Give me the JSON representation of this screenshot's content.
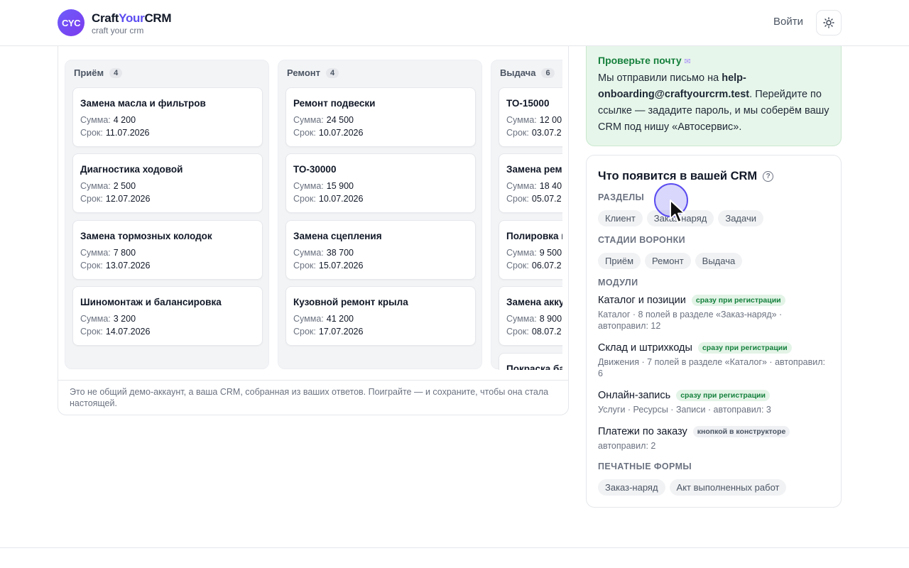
{
  "header": {
    "logo_text": "CYC",
    "brand_craft": "Craft",
    "brand_your": "Your",
    "brand_crm": "CRM",
    "brand_sub": "craft your crm",
    "login": "Войти"
  },
  "board": {
    "columns": [
      {
        "title": "Приём",
        "count": "4",
        "cards": [
          {
            "title": "Замена масла и фильтров",
            "sum": "4 200",
            "due": "11.07.2026"
          },
          {
            "title": "Диагностика ходовой",
            "sum": "2 500",
            "due": "12.07.2026"
          },
          {
            "title": "Замена тормозных колодок",
            "sum": "7 800",
            "due": "13.07.2026"
          },
          {
            "title": "Шиномонтаж и балансировка",
            "sum": "3 200",
            "due": "14.07.2026"
          }
        ]
      },
      {
        "title": "Ремонт",
        "count": "4",
        "cards": [
          {
            "title": "Ремонт подвески",
            "sum": "24 500",
            "due": "10.07.2026"
          },
          {
            "title": "ТО-30000",
            "sum": "15 900",
            "due": "10.07.2026"
          },
          {
            "title": "Замена сцепления",
            "sum": "38 700",
            "due": "15.07.2026"
          },
          {
            "title": "Кузовной ремонт крыла",
            "sum": "41 200",
            "due": "17.07.2026"
          }
        ]
      },
      {
        "title": "Выдача",
        "count": "6",
        "cards": [
          {
            "title": "ТО-15000",
            "sum": "12 00",
            "due": "03.07.2"
          },
          {
            "title": "Замена ремн",
            "sum": "18 40",
            "due": "05.07.2"
          },
          {
            "title": "Полировка к",
            "sum": "9 500",
            "due": "06.07.2"
          },
          {
            "title": "Замена акку",
            "sum": "8 900",
            "due": "08.07.2"
          },
          {
            "title": "Покраска ба",
            "sum": "",
            "due": ""
          }
        ]
      }
    ],
    "sum_label": "Сумма:",
    "due_label": "Срок:",
    "footer": "Это не общий демо-аккаунт, а ваша CRM, собранная из ваших ответов. Поиграйте — и сохраните, чтобы она стала настоящей."
  },
  "mail": {
    "title": "Проверьте почту",
    "text_pre": "Мы отправили письмо на ",
    "email": "help-onboarding@craftyourcrm.test",
    "text_post": ". Перейдите по ссылке — зададите пароль, и мы соберём вашу CRM под нишу «Автосервис»."
  },
  "features": {
    "title": "Что появится в вашей CRM",
    "sections_label": "РАЗДЕЛЫ",
    "sections": [
      "Клиент",
      "Заказ-наряд",
      "Задачи"
    ],
    "stages_label": "СТАДИИ ВОРОНКИ",
    "stages": [
      "Приём",
      "Ремонт",
      "Выдача"
    ],
    "modules_label": "МОДУЛИ",
    "modules": [
      {
        "name": "Каталог и позиции",
        "badge": "сразу при регистрации",
        "badge_type": "green",
        "desc": "Каталог · 8 полей в разделе «Заказ-наряд» · автоправил: 12"
      },
      {
        "name": "Склад и штрихкоды",
        "badge": "сразу при регистрации",
        "badge_type": "green",
        "desc": "Движения · 7 полей в разделе «Каталог» · автоправил: 6"
      },
      {
        "name": "Онлайн-запись",
        "badge": "сразу при регистрации",
        "badge_type": "green",
        "desc": "Услуги · Ресурсы · Записи · автоправил: 3"
      },
      {
        "name": "Платежи по заказу",
        "badge": "кнопкой в конструкторе",
        "badge_type": "gray",
        "desc": "автоправил: 2"
      }
    ],
    "print_label": "ПЕЧАТНЫЕ ФОРМЫ",
    "print_forms": [
      "Заказ-наряд",
      "Акт выполненных работ"
    ]
  }
}
